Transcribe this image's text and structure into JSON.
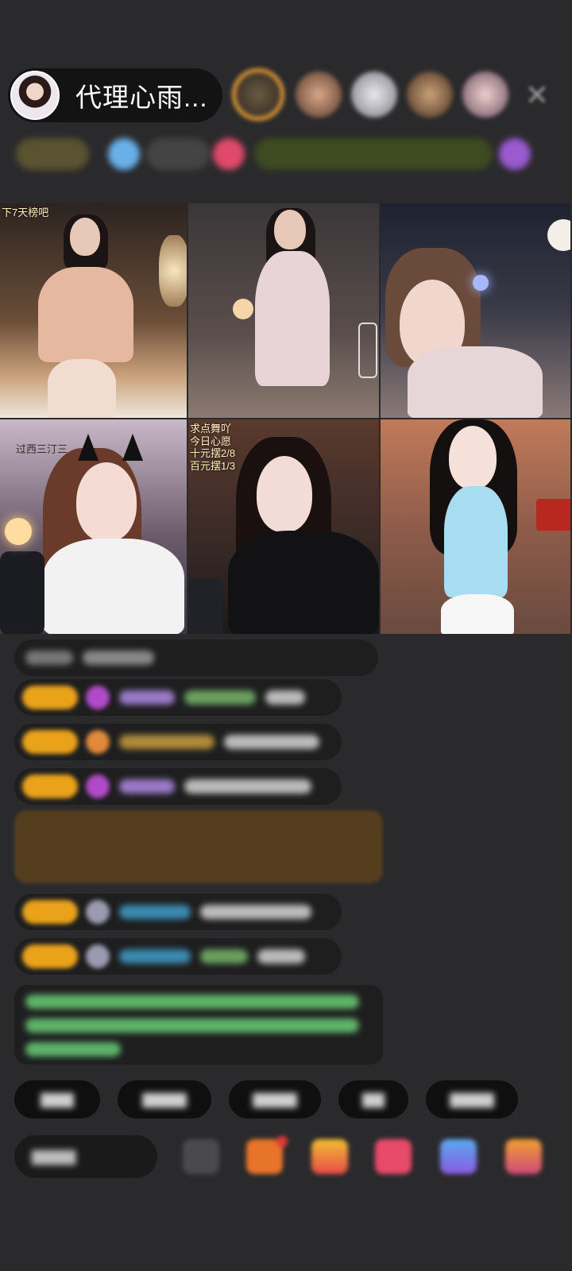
{
  "header": {
    "host_name": "代理心雨...",
    "close_symbol": "✕"
  },
  "grid": {
    "cells": [
      {
        "caption": "下7天榜吧"
      },
      {
        "caption": ""
      },
      {
        "caption": ""
      },
      {
        "caption": "过西三汀三"
      },
      {
        "caption": "求点舞吖\n今日心愿\n十元摆2/8\n百元摆1/3"
      },
      {
        "caption": ""
      }
    ]
  },
  "colors": {
    "badge_gold": "#e9a21a",
    "accent_orange": "#e39a37",
    "notice_green": "#5fb36a"
  },
  "quick_replies": [
    "",
    "",
    "",
    "",
    ""
  ],
  "input": {
    "placeholder": ""
  }
}
